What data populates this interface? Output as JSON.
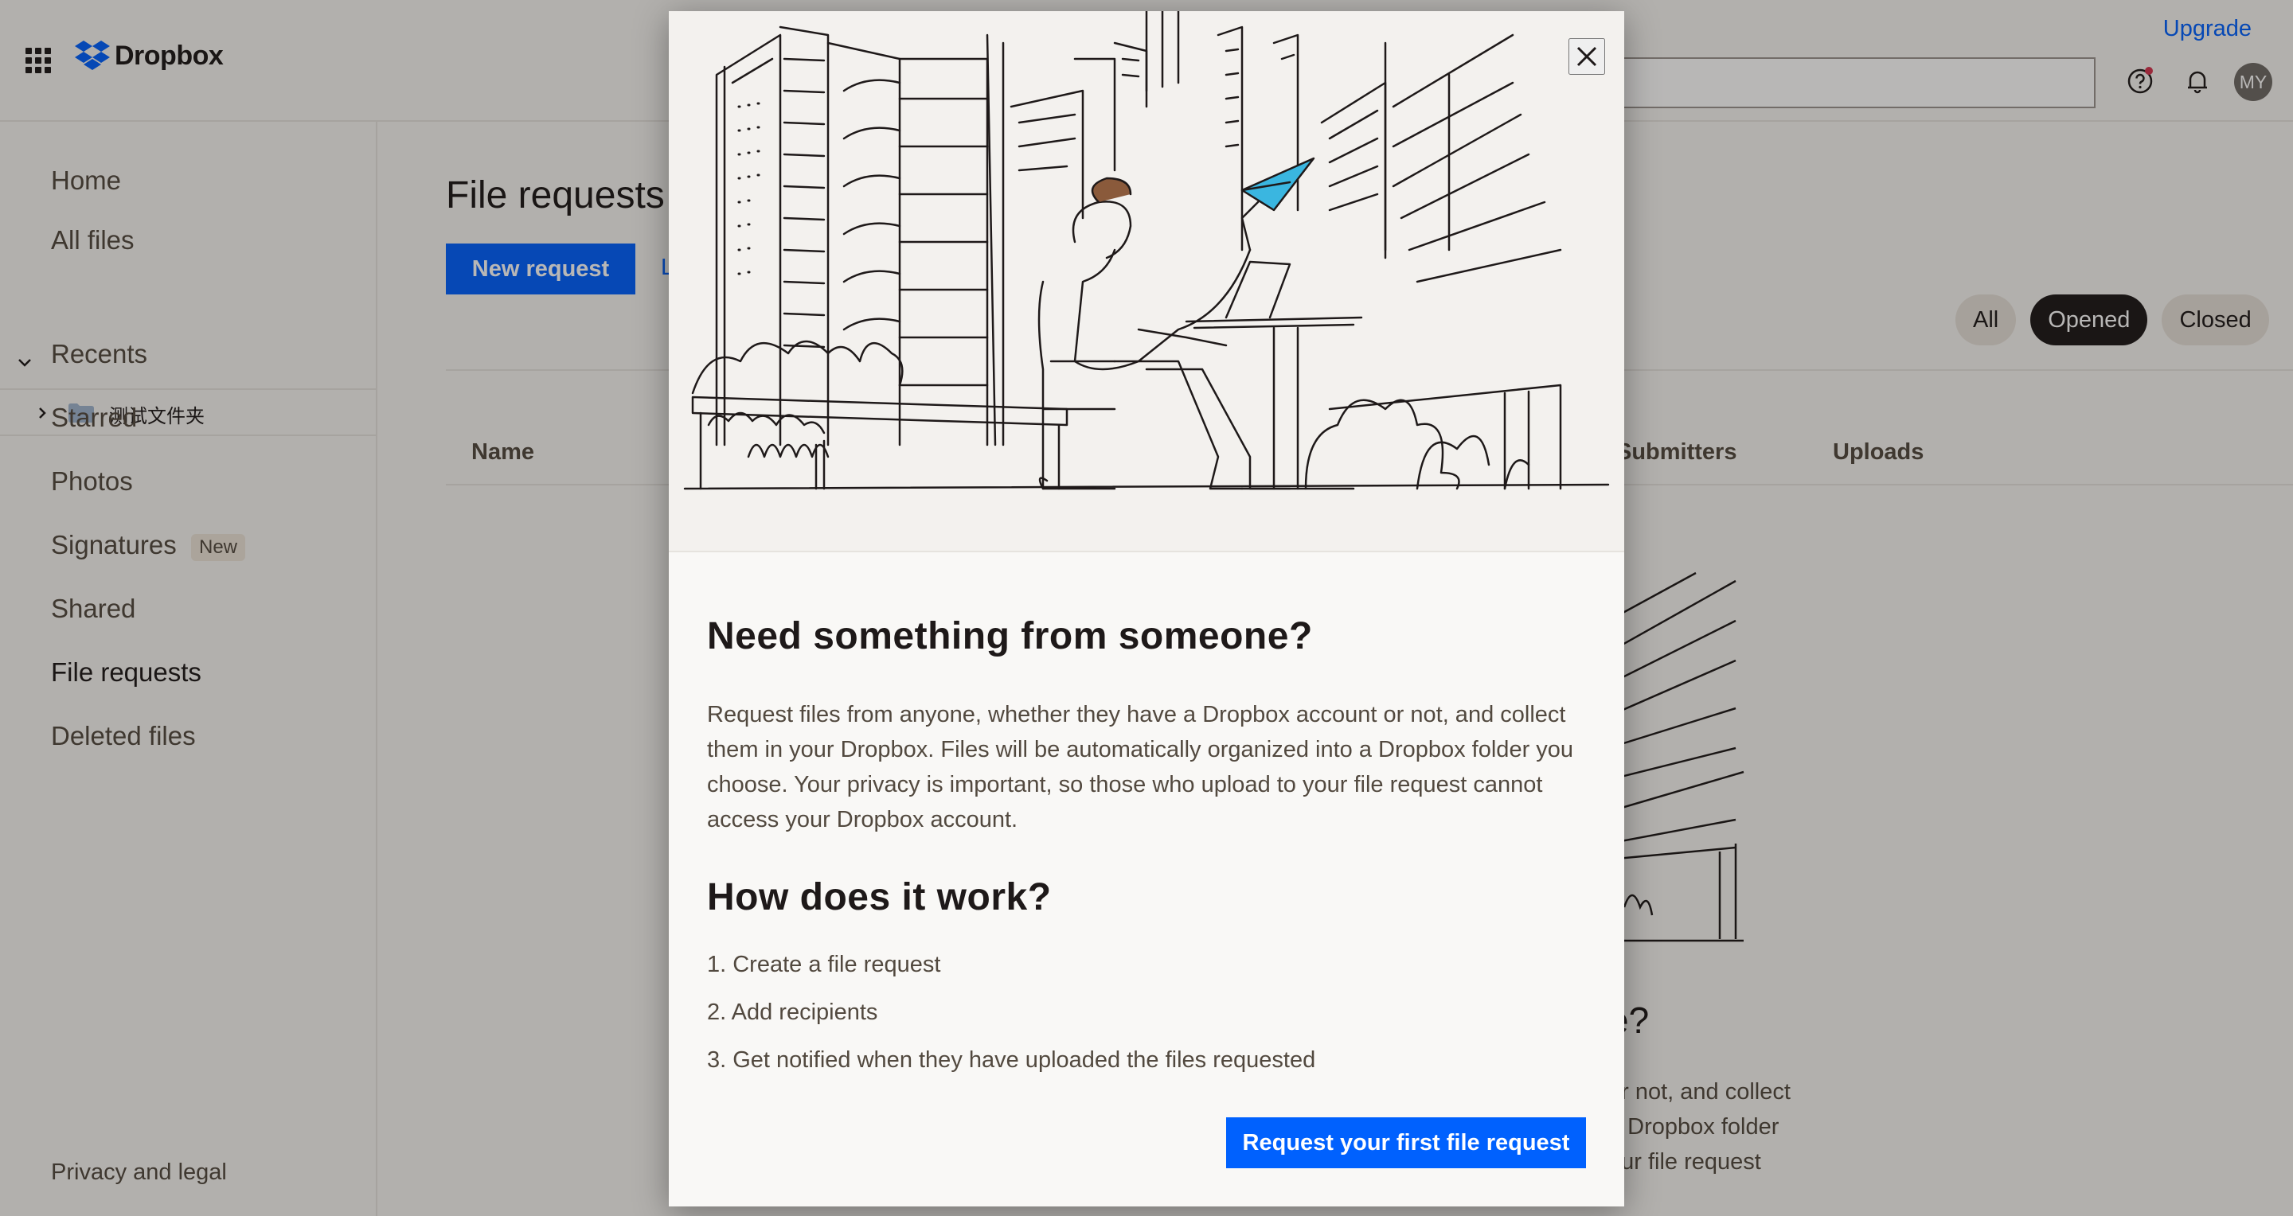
{
  "header": {
    "brand": "Dropbox",
    "upgrade_link": "Upgrade",
    "avatar_initials": "MY",
    "brand_color": "#0061fe"
  },
  "sidebar": {
    "items": [
      {
        "label": "Home"
      },
      {
        "label": "All files"
      },
      {
        "label": "Recents"
      },
      {
        "label": "Starred"
      },
      {
        "label": "Photos"
      },
      {
        "label": "Signatures",
        "badge": "New"
      },
      {
        "label": "Shared"
      },
      {
        "label": "File requests"
      },
      {
        "label": "Deleted files"
      }
    ],
    "folder": {
      "name": "测试文件夹"
    },
    "footer_link": "Privacy and legal"
  },
  "main": {
    "title": "File requests",
    "new_request_button": "New request",
    "learn_link": "L",
    "filters": [
      "All",
      "Opened",
      "Closed"
    ],
    "selected_filter": "Opened",
    "columns": [
      "Name",
      "Submitters",
      "Uploads"
    ],
    "empty_heading_fragment": "e?",
    "empty_text_fragments": [
      "or not, and collect",
      "a Dropbox folder",
      "our file request"
    ]
  },
  "modal": {
    "heading": "Need something from someone?",
    "description": "Request files from anyone, whether they have a Dropbox account or not, and collect them in your Dropbox. Files will be automatically organized into a Dropbox folder you choose. Your privacy is important, so those who upload to your file request cannot access your Dropbox account.",
    "how_heading": "How does it work?",
    "steps": [
      "1. Create a file request",
      "2. Add recipients",
      "3. Get notified when they have uploaded the files requested"
    ],
    "cta_button": "Request your first file request",
    "paper_plane_color": "#3ab6e0"
  }
}
